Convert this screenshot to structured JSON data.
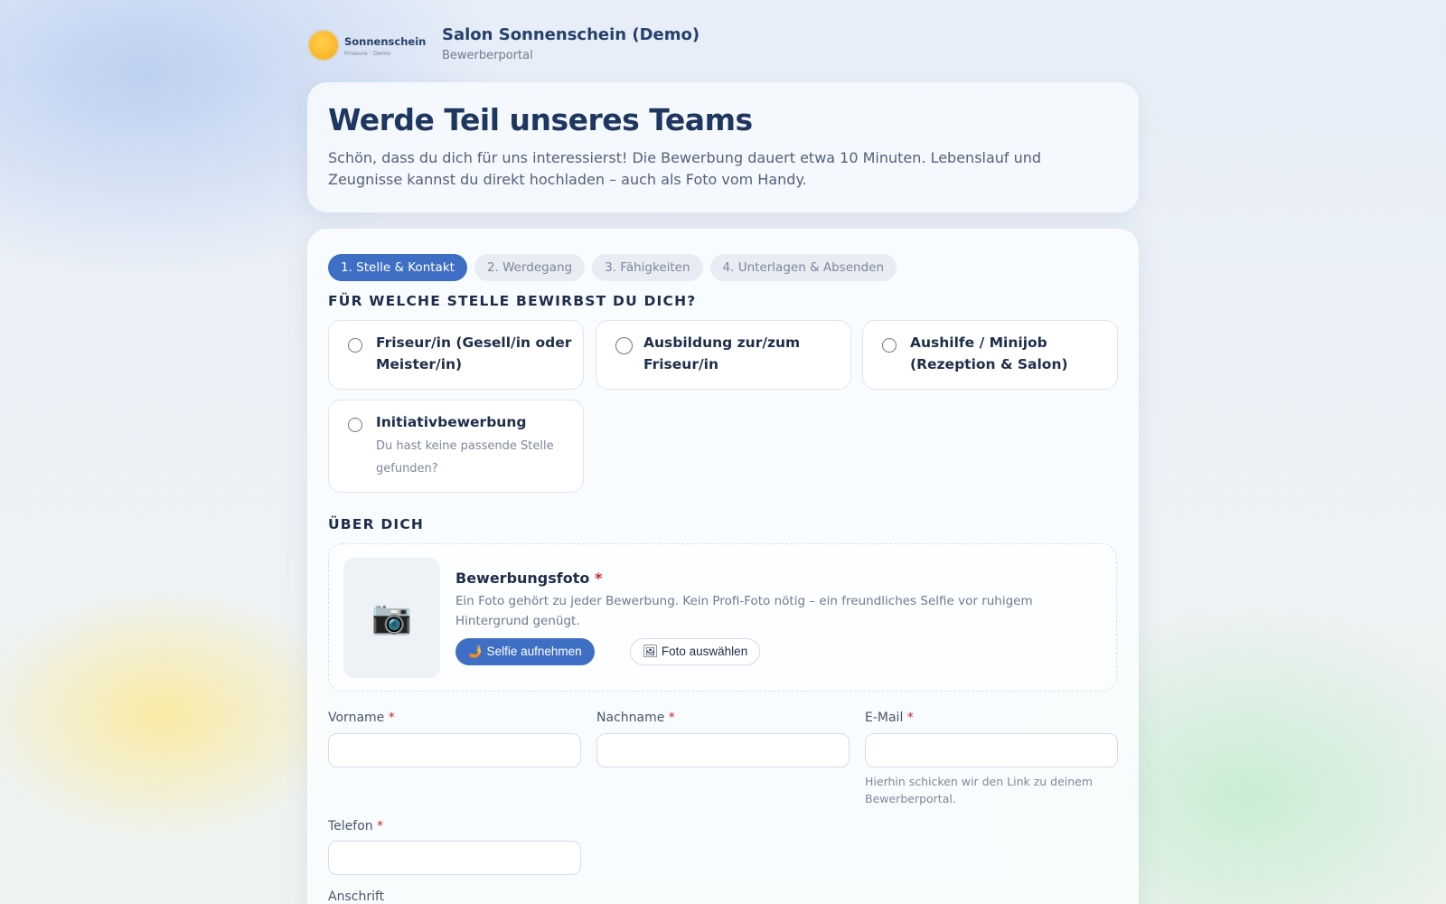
{
  "header": {
    "logo_name": "Sonnenschein",
    "logo_sub": "Friseure · Demo",
    "title": "Salon Sonnenschein (Demo)",
    "subtitle": "Bewerberportal"
  },
  "hero": {
    "title": "Werde Teil unseres Teams",
    "text": "Schön, dass du dich für uns interessierst! Die Bewerbung dauert etwa 10 Minuten. Lebenslauf und Zeugnisse kannst du direkt hochladen – auch als Foto vom Handy."
  },
  "steps": [
    {
      "label": "1. Stelle & Kontakt",
      "active": true
    },
    {
      "label": "2. Werdegang",
      "active": false
    },
    {
      "label": "3. Fähigkeiten",
      "active": false
    },
    {
      "label": "4. Unterlagen & Absenden",
      "active": false
    }
  ],
  "position_section": {
    "title": "FÜR WELCHE STELLE BEWIRBST DU DICH?",
    "options": [
      {
        "label": "Friseur/in (Gesell/in oder Meister/in)",
        "description": "",
        "selected": false
      },
      {
        "label": "Ausbildung zur/zum Friseur/in",
        "description": "",
        "selected": false
      },
      {
        "label": "Aushilfe / Minijob (Rezeption & Salon)",
        "description": "",
        "selected": false
      },
      {
        "label": "Initiativbewerbung",
        "description": "Du hast keine passende Stelle gefunden?",
        "selected": false
      }
    ]
  },
  "about_section": {
    "title": "ÜBER DICH",
    "photo": {
      "icon": "camera-icon",
      "title": "Bewerbungsfoto",
      "required_mark": "*",
      "text": "Ein Foto gehört zu jeder Bewerbung. Kein Profi-Foto nötig – ein freundliches Selfie vor ruhigem Hintergrund genügt.",
      "selfie_button": "🤳 Selfie aufnehmen",
      "choose_button": "🖼 Foto auswählen"
    },
    "fields": {
      "first_name": {
        "label": "Vorname",
        "required_mark": "*",
        "value": ""
      },
      "last_name": {
        "label": "Nachname",
        "required_mark": "*",
        "value": ""
      },
      "email": {
        "label": "E-Mail",
        "required_mark": "*",
        "value": "",
        "hint": "Hierhin schicken wir den Link zu deinem Bewerberportal."
      },
      "phone": {
        "label": "Telefon",
        "required_mark": "*",
        "value": ""
      },
      "address": {
        "label": "Anschrift"
      }
    }
  },
  "colors": {
    "accent": "#3f6fc4",
    "heading": "#1e3760",
    "required": "#c62828"
  }
}
